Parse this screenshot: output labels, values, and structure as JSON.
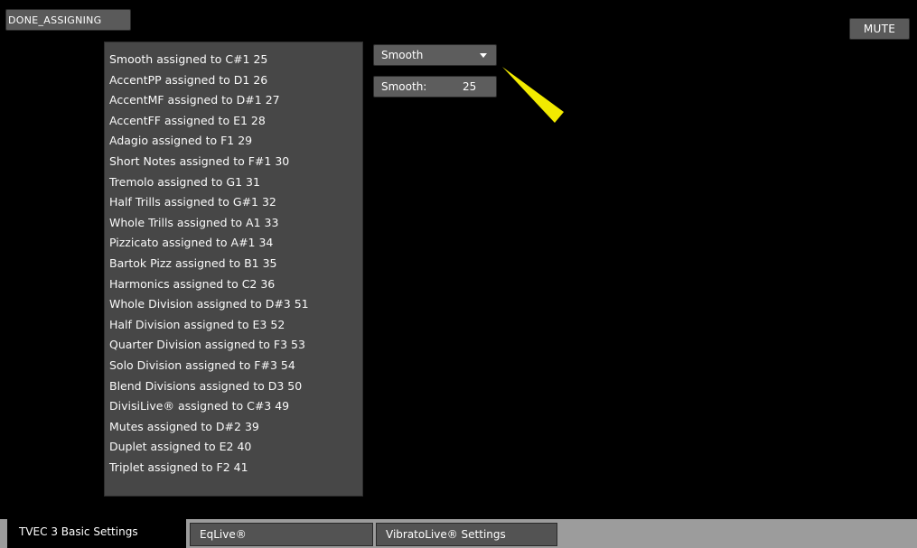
{
  "toolbar": {
    "done_label": "DONE_ASSIGNING",
    "mute_label": "MUTE"
  },
  "assignments": [
    "Smooth assigned to C#1  25",
    "AccentPP assigned to D1  26",
    "AccentMF assigned to D#1  27",
    "AccentFF assigned to E1  28",
    "Adagio assigned to F1  29",
    "Short Notes  assigned to F#1  30",
    "Tremolo assigned to G1  31",
    "Half Trills assigned to G#1  32",
    "Whole Trills assigned to A1  33",
    "Pizzicato assigned to A#1  34",
    "Bartok Pizz assigned to B1  35",
    "Harmonics assigned to C2  36",
    "Whole Division assigned to D#3  51",
    "Half Division assigned to E3  52",
    "Quarter Division assigned to F3  53",
    "Solo Division assigned to F#3  54",
    "Blend Divisions assigned to D3  50",
    "DivisiLive® assigned to C#3  49",
    "Mutes assigned to D#2  39",
    "Duplet assigned to E2  40",
    "Triplet assigned to F2  41"
  ],
  "articulation_select": {
    "value": "Smooth"
  },
  "cc_field": {
    "label": "Smooth:",
    "value": "25"
  },
  "tabs": [
    {
      "label": "TVEC 3 Basic Settings"
    },
    {
      "label": "EqLive®"
    },
    {
      "label": "VibratoLive® Settings"
    }
  ],
  "colors": {
    "pointer": "#f2ea00",
    "panel": "#474747",
    "background": "#000000"
  }
}
